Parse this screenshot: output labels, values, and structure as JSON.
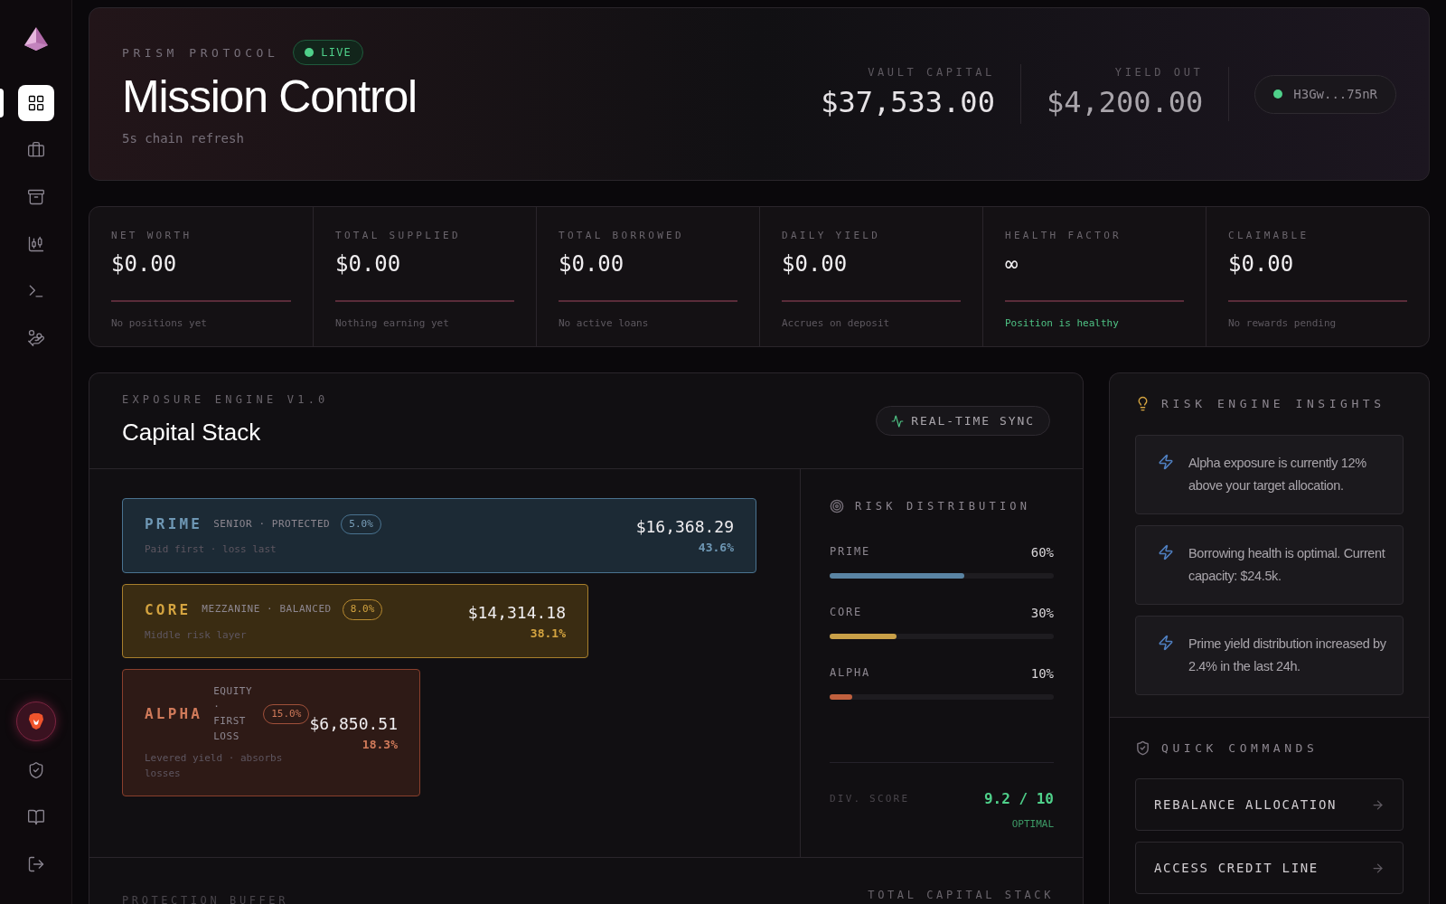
{
  "sidebar": {
    "items": [
      {
        "kind": "grid",
        "selected": true
      },
      {
        "kind": "briefcase",
        "selected": false
      },
      {
        "kind": "archive",
        "selected": false
      },
      {
        "kind": "chart",
        "selected": false
      },
      {
        "kind": "terminal",
        "selected": false
      },
      {
        "kind": "coins",
        "selected": false
      }
    ],
    "bottom_items": [
      {
        "kind": "avatar"
      },
      {
        "kind": "shield"
      },
      {
        "kind": "book"
      },
      {
        "kind": "logout"
      }
    ]
  },
  "header": {
    "eyebrow": "PRISM PROTOCOL",
    "status": "LIVE",
    "title": "Mission Control",
    "subtitle": "5s chain refresh",
    "metrics": [
      {
        "label": "VAULT CAPITAL",
        "value": "$37,533.00"
      },
      {
        "label": "YIELD OUT",
        "value": "$4,200.00"
      }
    ],
    "wallet": "H3Gw...75nR"
  },
  "stats": [
    {
      "label": "NET WORTH",
      "value": "$0.00",
      "note": "No positions yet",
      "healthy": false
    },
    {
      "label": "TOTAL SUPPLIED",
      "value": "$0.00",
      "note": "Nothing earning yet",
      "healthy": false
    },
    {
      "label": "TOTAL BORROWED",
      "value": "$0.00",
      "note": "No active loans",
      "healthy": false
    },
    {
      "label": "DAILY YIELD",
      "value": "$0.00",
      "note": "Accrues on deposit",
      "healthy": false
    },
    {
      "label": "HEALTH FACTOR",
      "value": "∞",
      "note": "Position is healthy",
      "healthy": true
    },
    {
      "label": "CLAIMABLE",
      "value": "$0.00",
      "note": "No rewards pending",
      "healthy": false
    }
  ],
  "capital_stack": {
    "eyebrow": "EXPOSURE ENGINE V1.0",
    "title": "Capital Stack",
    "sync": "REAL-TIME SYNC",
    "tranches": [
      {
        "kind": "prime",
        "name": "PRIME",
        "tag": "SENIOR · PROTECTED",
        "rate": "5.0%",
        "description": "Paid first · loss last",
        "amount": "$16,368.29",
        "share": "43.6%"
      },
      {
        "kind": "core",
        "name": "CORE",
        "tag": "MEZZANINE · BALANCED",
        "rate": "8.0%",
        "description": "Middle risk layer",
        "amount": "$14,314.18",
        "share": "38.1%"
      },
      {
        "kind": "alpha",
        "name": "ALPHA",
        "tag": "EQUITY · FIRST LOSS",
        "rate": "15.0%",
        "description": "Levered yield · absorbs losses",
        "amount": "$6,850.51",
        "share": "18.3%"
      }
    ],
    "distribution": {
      "title": "RISK DISTRIBUTION",
      "rows": [
        {
          "kind": "prime",
          "label": "PRIME",
          "value": "60%",
          "level": 0.6
        },
        {
          "kind": "core",
          "label": "CORE",
          "value": "30%",
          "level": 0.3
        },
        {
          "kind": "alpha",
          "label": "ALPHA",
          "value": "10%",
          "level": 0.1
        }
      ],
      "score_label": "DIV. SCORE",
      "score": "9.2 / 10",
      "score_status": "OPTIMAL"
    },
    "footer_left": "PROTECTION BUFFER",
    "footer_right": "TOTAL CAPITAL STACK"
  },
  "insights": {
    "title": "RISK ENGINE INSIGHTS",
    "items": [
      "Alpha exposure is currently 12% above your target allocation.",
      "Borrowing health is optimal. Current capacity: $24.5k.",
      "Prime yield distribution increased by 2.4% in the last 24h."
    ]
  },
  "quick_commands": {
    "title": "QUICK COMMANDS",
    "items": [
      "REBALANCE ALLOCATION",
      "ACCESS CREDIT LINE"
    ]
  }
}
